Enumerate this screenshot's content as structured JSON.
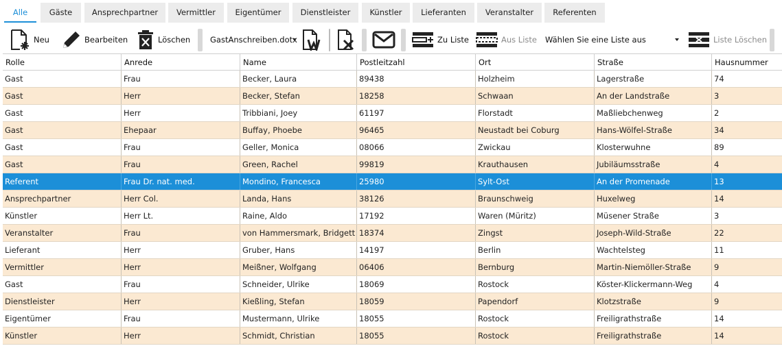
{
  "tabs": [
    "Alle",
    "Gäste",
    "Ansprechpartner",
    "Vermittler",
    "Eigentümer",
    "Dienstleister",
    "Künstler",
    "Lieferanten",
    "Veranstalter",
    "Referenten"
  ],
  "active_tab": "Alle",
  "toolbar": {
    "new_label": "Neu",
    "edit_label": "Bearbeiten",
    "delete_label": "Löschen",
    "template_select": "GastAnschreiben.dotx",
    "to_list_label": "Zu Liste",
    "from_list_label": "Aus Liste",
    "list_select": "Wählen Sie eine Liste aus",
    "delete_list_label": "Liste Löschen"
  },
  "table": {
    "columns": [
      "Rolle",
      "Anrede",
      "Name",
      "Postleitzahl",
      "Ort",
      "Straße",
      "Hausnummer"
    ],
    "selected_row": 6,
    "rows": [
      [
        "Gast",
        "Frau",
        "Becker, Laura",
        "89438",
        "Holzheim",
        "Lagerstraße",
        "74"
      ],
      [
        "Gast",
        "Herr",
        "Becker, Stefan",
        "18258",
        "Schwaan",
        "An der Landstraße",
        "3"
      ],
      [
        "Gast",
        "Herr",
        "Tribbiani, Joey",
        "61197",
        "Florstadt",
        "Maßliebchenweg",
        "2"
      ],
      [
        "Gast",
        "Ehepaar",
        "Buffay, Phoebe",
        "96465",
        "Neustadt bei Coburg",
        "Hans-Wölfel-Straße",
        "34"
      ],
      [
        "Gast",
        "Frau",
        "Geller, Monica",
        "08066",
        "Zwickau",
        "Klosterwuhne",
        "89"
      ],
      [
        "Gast",
        "Frau",
        "Green, Rachel",
        "99819",
        "Krauthausen",
        "Jubiläumsstraße",
        "4"
      ],
      [
        "Referent",
        "Frau Dr. nat. med.",
        "Mondino, Francesca",
        "25980",
        "Sylt-Ost",
        "An der Promenade",
        "13"
      ],
      [
        "Ansprechpartner",
        "Herr Col.",
        "Landa, Hans",
        "38126",
        "Braunschweig",
        "Huxelweg",
        "14"
      ],
      [
        "Künstler",
        "Herr Lt.",
        "Raine, Aldo",
        "17192",
        "Waren (Müritz)",
        "Müsener Straße",
        "3"
      ],
      [
        "Veranstalter",
        "Frau",
        "von Hammersmark, Bridgett",
        "18374",
        "Zingst",
        "Joseph-Wild-Straße",
        "22"
      ],
      [
        "Lieferant",
        "Herr",
        "Gruber, Hans",
        "14197",
        "Berlin",
        "Wachtelsteg",
        "11"
      ],
      [
        "Vermittler",
        "Herr",
        "Meißner, Wolfgang",
        "06406",
        "Bernburg",
        "Martin-Niemöller-Straße",
        "9"
      ],
      [
        "Gast",
        "Frau",
        "Schneider, Ulrike",
        "18069",
        "Rostock",
        "Köster-Klickermann-Weg",
        "4"
      ],
      [
        "Dienstleister",
        "Herr",
        "Kießling, Stefan",
        "18059",
        "Papendorf",
        "Klotzstraße",
        "9"
      ],
      [
        "Eigentümer",
        "Frau",
        "Mustermann, Ulrike",
        "18055",
        "Rostock",
        "Freiligrathstraße",
        "14"
      ],
      [
        "Künstler",
        "Herr",
        "Schmidt, Christian",
        "18055",
        "Rostock",
        "Freiligrathstraße",
        "14"
      ]
    ]
  },
  "colors": {
    "accent": "#1c8fd8",
    "row_alt": "#fbe9d2",
    "tab_bg": "#ececec"
  }
}
